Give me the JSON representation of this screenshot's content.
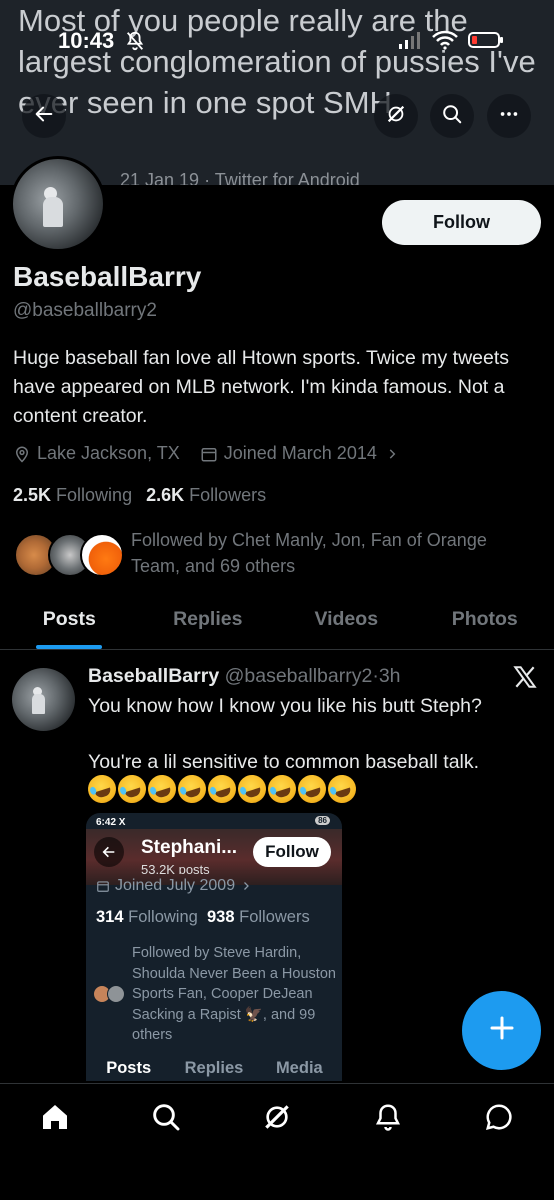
{
  "banner": {
    "tweet_text": "Most of you people really are the largest conglomeration of pussies I've ever seen in one spot SMH",
    "tweet_meta": "21 Jan 19 · Twitter for Android"
  },
  "status_bar": {
    "time": "10:43"
  },
  "header": {
    "back_icon": "arrow-left-icon",
    "grok_icon": "grok-icon",
    "search_icon": "search-icon",
    "more_icon": "more-icon"
  },
  "profile": {
    "display_name": "BaseballBarry",
    "handle": "@baseballbarry2",
    "follow_label": "Follow",
    "bio": "Huge baseball fan love all Htown sports. Twice my tweets have appeared on MLB network. I'm kinda famous. Not a content creator.",
    "location": "Lake Jackson, TX",
    "joined": "Joined March 2014",
    "following_count": "2.5K",
    "following_label": "Following",
    "followers_count": "2.6K",
    "followers_label": "Followers",
    "followed_by": "Followed by Chet Manly, Jon, Fan of Orange Team, and 69 others"
  },
  "tabs": [
    {
      "label": "Posts",
      "active": true
    },
    {
      "label": "Replies",
      "active": false
    },
    {
      "label": "Videos",
      "active": false
    },
    {
      "label": "Photos",
      "active": false
    }
  ],
  "post": {
    "author_name": "BaseballBarry",
    "author_handle": "@baseballbarry2",
    "time": "3h",
    "separator": "·",
    "line1": "You know how I know you like his butt Steph?",
    "line2": "You're a lil sensitive to common baseball talk.",
    "emoji_count": 9,
    "embed": {
      "status_time": "6:42",
      "status_x": "X",
      "battery": "86",
      "name": "Stephani...",
      "posts_label": "53.2K posts",
      "follow_label": "Follow",
      "joined": "Joined July 2009",
      "following_count": "314",
      "following_label": "Following",
      "followers_count": "938",
      "followers_label": "Followers",
      "followed_by": "Followed by Steve Hardin, Shoulda Never Been a Houston Sports Fan, Cooper DeJean Sacking a Rapist 🦅, and 99 others",
      "tabs": [
        "Posts",
        "Replies",
        "Media"
      ]
    }
  },
  "fab": {
    "icon": "plus-icon"
  },
  "bottom_nav": [
    {
      "name": "home-icon"
    },
    {
      "name": "search-icon"
    },
    {
      "name": "grok-icon"
    },
    {
      "name": "notifications-icon"
    },
    {
      "name": "messages-icon"
    }
  ],
  "colors": {
    "accent": "#1d9bf0",
    "background": "#000000",
    "muted": "#71767b",
    "text": "#e7e9ea"
  }
}
